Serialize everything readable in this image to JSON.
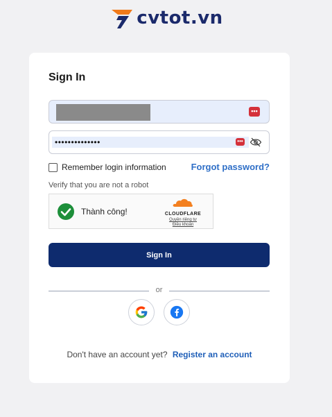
{
  "logo": {
    "text": "cvtot.vn",
    "icon": "cvtot-logo-icon"
  },
  "form": {
    "title": "Sign In",
    "email": {
      "value": "",
      "placeholder": ""
    },
    "password": {
      "value": "••••••••••••••",
      "placeholder": ""
    },
    "remember_label": "Remember login information",
    "forgot_label": "Forgot password?",
    "verify_label": "Verify that you are not a robot",
    "captcha": {
      "status": "Thành công!",
      "provider": "CLOUDFLARE",
      "privacy_link": "Quyền riêng tư",
      "terms_link": "Điều khoản"
    },
    "submit_label": "Sign In",
    "divider_label": "or",
    "register_prompt": "Don't have an account yet?",
    "register_link": "Register an account"
  },
  "colors": {
    "page_bg": "#f1f1f3",
    "primary": "#0e2b6e",
    "link": "#2f6fc7",
    "success": "#1d8f3a",
    "cloudflare": "#f38020",
    "autofill": "#e7eefc"
  }
}
